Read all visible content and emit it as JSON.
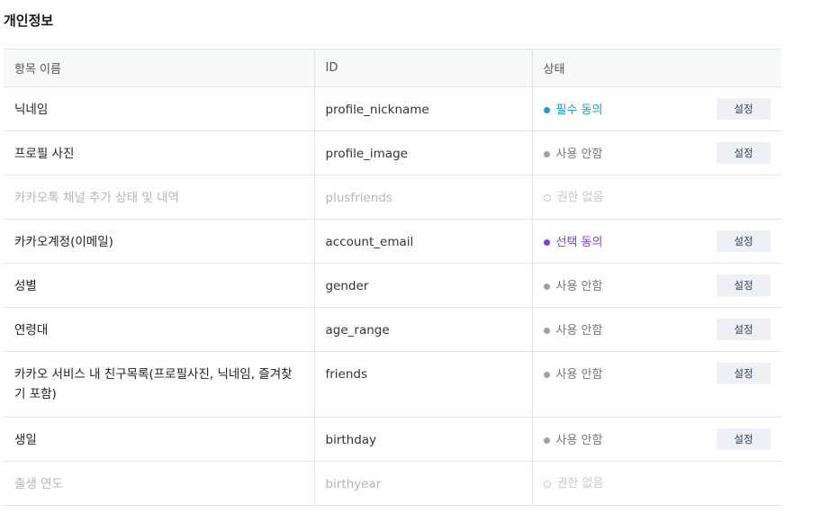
{
  "section": {
    "title": "개인정보"
  },
  "table": {
    "headers": {
      "name": "항목 이름",
      "id": "ID",
      "status": "상태"
    },
    "rows": [
      {
        "name": "닉네임",
        "id": "profile_nickname",
        "status": "필수 동의",
        "action": "설정"
      },
      {
        "name": "프로필 사진",
        "id": "profile_image",
        "status": "사용 안함",
        "action": "설정"
      },
      {
        "name": "카카오톡 채널 추가 상태 및 내역",
        "id": "plusfriends",
        "status": "권한 없음",
        "action": ""
      },
      {
        "name": "카카오계정(이메일)",
        "id": "account_email",
        "status": "선택 동의",
        "action": "설정"
      },
      {
        "name": "성별",
        "id": "gender",
        "status": "사용 안함",
        "action": "설정"
      },
      {
        "name": "연령대",
        "id": "age_range",
        "status": "사용 안함",
        "action": "설정"
      },
      {
        "name": "카카오 서비스 내 친구목록(프로필사진, 닉네임, 즐겨찾기 포함)",
        "id": "friends",
        "status": "사용 안함",
        "action": "설정"
      },
      {
        "name": "생일",
        "id": "birthday",
        "status": "사용 안함",
        "action": "설정"
      },
      {
        "name": "출생 연도",
        "id": "birthyear",
        "status": "권한 없음",
        "action": ""
      }
    ]
  },
  "colors": {
    "required": "#1b9bd8",
    "optional": "#7d3fd8",
    "unused": "#a0a0a0",
    "no_permission": "#c8c8c8"
  }
}
